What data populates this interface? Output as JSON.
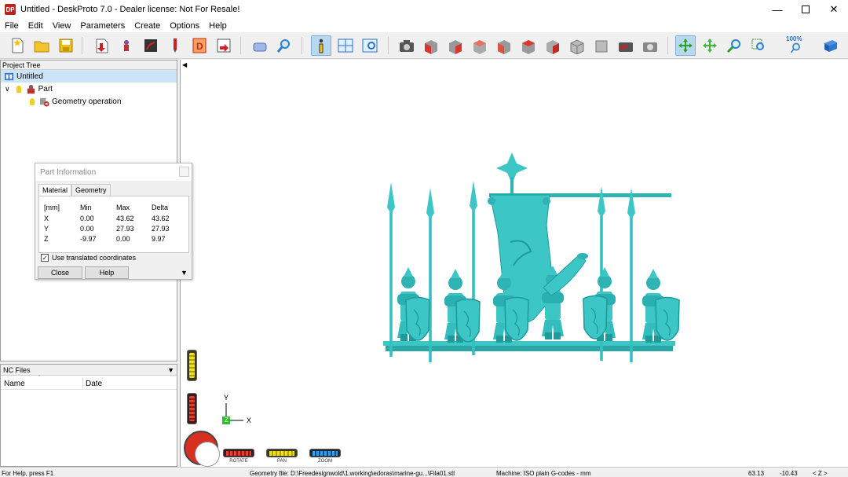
{
  "window": {
    "title": "Untitled - DeskProto 7.0 - Dealer license: Not For Resale!",
    "logo": "DP",
    "min_icon": "minimize-icon",
    "max_icon": "maximize-icon",
    "close_icon": "close-icon"
  },
  "menu": [
    "File",
    "Edit",
    "View",
    "Parameters",
    "Create",
    "Options",
    "Help"
  ],
  "toolbar": {
    "zoom_label": "100%"
  },
  "project_tree": {
    "header": "Project Tree",
    "items": [
      {
        "label": "Untitled",
        "selected": true
      },
      {
        "label": "Part"
      },
      {
        "label": "Geometry operation"
      }
    ]
  },
  "part_info": {
    "title": "Part Information",
    "tabs": [
      "Material",
      "Geometry"
    ],
    "table": {
      "headers": [
        "[mm]",
        "Min",
        "Max",
        "Delta"
      ],
      "rows": [
        [
          "X",
          "0.00",
          "43.62",
          "43.62"
        ],
        [
          "Y",
          "0.00",
          "27.93",
          "27.93"
        ],
        [
          "Z",
          "-9.97",
          "0.00",
          "9.97"
        ]
      ]
    },
    "checkbox": {
      "label": "Use translated coordinates",
      "checked": true
    },
    "close_label": "Close",
    "help_label": "Help"
  },
  "nc_files": {
    "header": "NC Files",
    "columns": [
      "Name",
      "Date"
    ]
  },
  "axes": {
    "y": "Y",
    "x": "X",
    "z": "Z"
  },
  "controls": {
    "rotate": "ROTATE",
    "pan": "PAN",
    "zoom": "ZOOM"
  },
  "status": {
    "help": "For Help, press F1",
    "geometry": "Geometry file: D:\\Freedesignwold\\1.working\\edoras\\marine-gu...\\Fila01.stl",
    "machine": "Machine: ISO plain G-codes - mm",
    "x": "63.13",
    "y": "-10.43",
    "axis": "< Z >"
  },
  "colors": {
    "model": "#3cc6c6",
    "model_shadow": "#1f9a9a",
    "selection": "#cce4f7",
    "active_tool": "#b8d8f0"
  }
}
